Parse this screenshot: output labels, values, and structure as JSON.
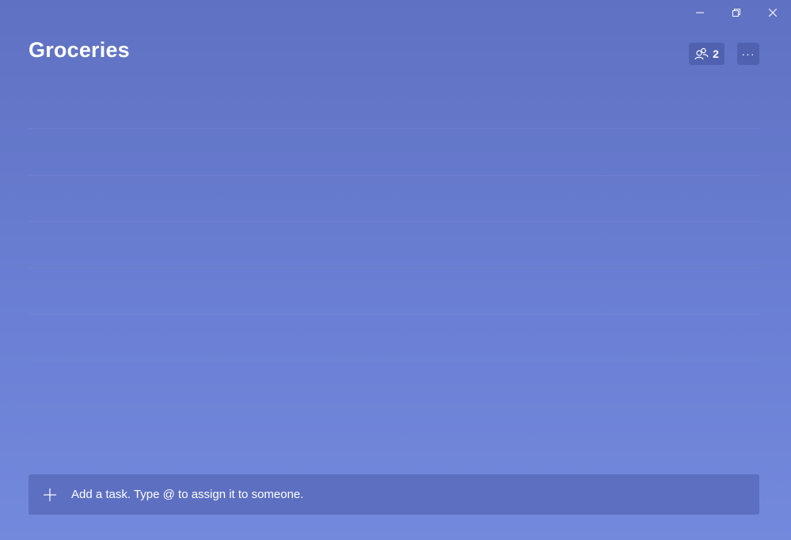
{
  "window": {
    "controls": [
      "minimize-icon",
      "restore-icon",
      "close-icon"
    ]
  },
  "list": {
    "title": "Groceries",
    "shared_count": "2"
  },
  "task_input": {
    "placeholder": "Add a task. Type @ to assign it to someone."
  },
  "colors": {
    "background_top": "#5f71c2",
    "background_bottom": "#7389dc",
    "input_bg": "#5d6fc0"
  }
}
